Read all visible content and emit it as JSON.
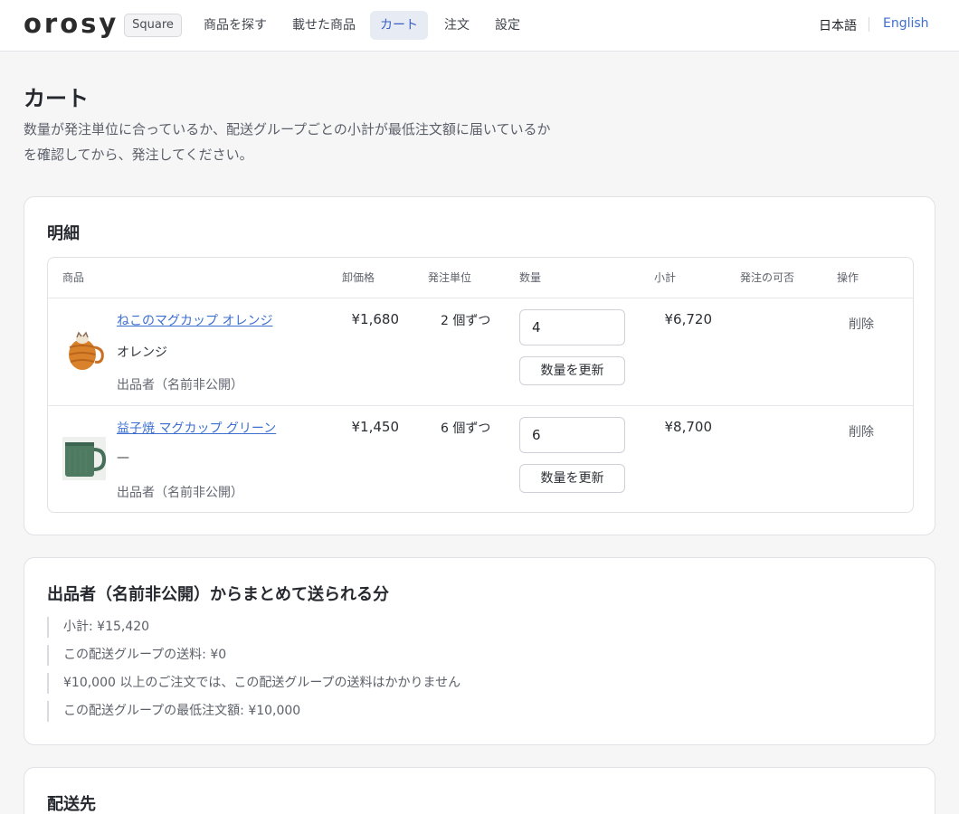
{
  "header": {
    "logo": "orosy",
    "plan_badge": "Square",
    "nav": [
      "商品を探す",
      "載せた商品",
      "カート",
      "注文",
      "設定"
    ],
    "active_nav": "カート",
    "lang_ja": "日本語",
    "lang_en": "English"
  },
  "page": {
    "title": "カート",
    "description_line1": "数量が発注単位に合っているか、配送グループごとの小計が最低注文額に届いているか",
    "description_line2": "を確認してから、発注してください。"
  },
  "details": {
    "title": "明細",
    "columns": [
      "商品",
      "卸価格",
      "発注単位",
      "数量",
      "小計",
      "発注の可否",
      "操作"
    ],
    "items": [
      {
        "name": "ねこのマグカップ オレンジ",
        "variant": "オレンジ",
        "seller": "出品者（名前非公開）",
        "price": "¥1,680",
        "unit": "2 個ずつ",
        "qty": "4",
        "update_label": "数量を更新",
        "subtotal": "¥6,720",
        "availability": "",
        "delete_label": "削除",
        "thumb_color": "#d9822b"
      },
      {
        "name": "益子焼 マグカップ グリーン",
        "variant": "—",
        "seller": "出品者（名前非公開）",
        "price": "¥1,450",
        "unit": "6 個ずつ",
        "qty": "6",
        "update_label": "数量を更新",
        "subtotal": "¥8,700",
        "availability": "",
        "delete_label": "削除",
        "thumb_color": "#4f7a62"
      }
    ]
  },
  "shipping_group": {
    "title": "出品者（名前非公開）からまとめて送られる分",
    "lines": [
      "小計: ¥15,420",
      "この配送グループの送料: ¥0",
      "¥10,000 以上のご注文では、この配送グループの送料はかかりません",
      "この配送グループの最低注文額: ¥10,000"
    ]
  },
  "destination": {
    "title": "配送先"
  },
  "colors": {
    "accent": "#3c6fd0",
    "nav_active_bg": "#e7ebf4",
    "background": "#f6f6f7"
  }
}
